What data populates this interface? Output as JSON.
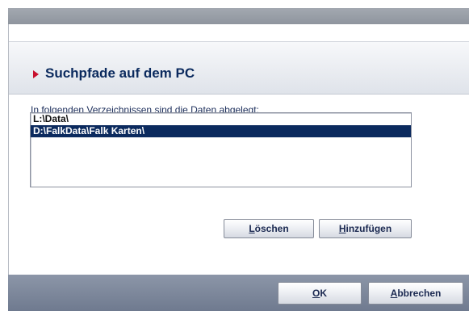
{
  "dialog": {
    "title": "Suchpfade auf dem PC",
    "description": "In folgenden Verzeichnissen sind die Daten abgelegt:"
  },
  "paths": [
    {
      "label": "L:\\Data\\",
      "selected": false
    },
    {
      "label": "D:\\FalkData\\Falk Karten\\",
      "selected": true
    }
  ],
  "buttons": {
    "delete": {
      "mnemonic": "L",
      "rest": "öschen"
    },
    "add": {
      "mnemonic": "H",
      "rest": "inzufügen"
    },
    "ok": {
      "mnemonic": "O",
      "rest": "K"
    },
    "cancel": {
      "mnemonic": "A",
      "rest": "bbrechen"
    }
  },
  "colors": {
    "accent_arrow": "#c8102e",
    "title_text": "#0b2a5e",
    "selection": "#0b2a5e",
    "footer": "#7a8497"
  },
  "icons": {
    "title_marker": "arrow-right-icon"
  }
}
